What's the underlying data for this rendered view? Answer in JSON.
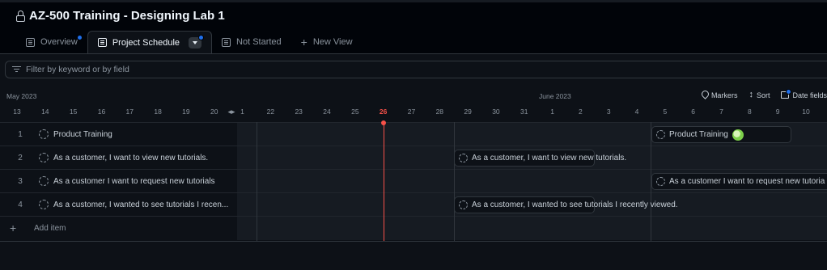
{
  "window": {
    "title": "AZ-500 Training - Designing Lab 1"
  },
  "tabs": [
    {
      "label": "Overview",
      "active": false,
      "has_dot": true
    },
    {
      "label": "Project Schedule",
      "active": true,
      "has_dot": true
    },
    {
      "label": "Not Started",
      "active": false,
      "has_dot": false
    }
  ],
  "new_view_label": "New View",
  "filter": {
    "placeholder": "Filter by keyword or by field"
  },
  "timeline": {
    "months": [
      "May 2023",
      "June 2023"
    ],
    "days": [
      "13",
      "14",
      "15",
      "16",
      "17",
      "18",
      "19",
      "20",
      "1",
      "22",
      "23",
      "24",
      "25",
      "26",
      "27",
      "28",
      "29",
      "30",
      "31",
      "1",
      "2",
      "3",
      "4",
      "5",
      "6",
      "7",
      "8",
      "9",
      "10"
    ],
    "today": "26",
    "controls": {
      "markers": "Markers",
      "sort": "Sort",
      "date_fields": "Date fields"
    }
  },
  "items": [
    {
      "num": "1",
      "title": "Product Training"
    },
    {
      "num": "2",
      "title": "As a customer, I want to view new tutorials."
    },
    {
      "num": "3",
      "title": "As a customer I want to request new tutorials"
    },
    {
      "num": "4",
      "title": "As a customer, I wanted to see tutorials I recen..."
    }
  ],
  "bars": [
    {
      "label": "Product Training",
      "row": 0,
      "has_avatar": true
    },
    {
      "label": "As a customer, I want to view new tutorials.",
      "row": 1
    },
    {
      "label": "As a customer I want to request new tutoria",
      "row": 2
    },
    {
      "label": "As a customer, I wanted to see tutorials I recently viewed.",
      "row": 3
    }
  ],
  "add_item_label": "Add item",
  "colors": {
    "background": "#0d1117",
    "today": "#f85149",
    "accent_dot": "#1f6feb"
  },
  "icons": {
    "lock": "lock-icon",
    "table": "table-icon",
    "filter": "filter-icon",
    "marker": "marker-icon",
    "sort": "sort-icon",
    "calendar": "calendar-icon"
  }
}
